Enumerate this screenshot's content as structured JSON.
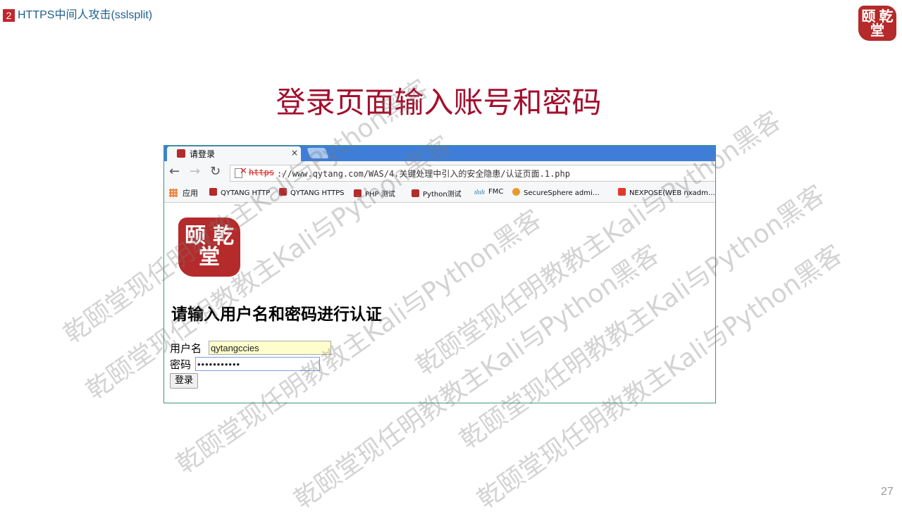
{
  "slide": {
    "section_number": "2",
    "section_title": "HTTPS中间人攻击(sslsplit)",
    "heading": "登录页面输入账号和密码",
    "page_number": "27",
    "watermark": "乾颐堂现任明教教主Kali与Python黑客"
  },
  "logo": {
    "text": [
      "颐",
      "乾",
      "堂"
    ],
    "color": "#b52a2a"
  },
  "browser": {
    "tab": {
      "title": "请登录",
      "close": "×"
    },
    "nav": {
      "back": "←",
      "forward": "→",
      "reload": "↻"
    },
    "address": {
      "scheme": "https",
      "rest": "://www.qytang.com/WAS/4.关键处理中引入的安全隐患/认证页面.1.php",
      "ssl_error_icon": "x-icon"
    },
    "bookmarks": {
      "apps_label": "应用",
      "items": [
        {
          "label": "QYTANG HTTP",
          "icon": "qytang-icon"
        },
        {
          "label": "QYTANG HTTPS",
          "icon": "qytang-icon"
        },
        {
          "label": "PHP 测试",
          "icon": "qytang-icon"
        },
        {
          "label": "Python测试",
          "icon": "qytang-icon"
        },
        {
          "label": "FMC",
          "icon": "cisco-icon"
        },
        {
          "label": "SecureSphere admi…",
          "icon": "securesphere-icon"
        },
        {
          "label": "NEXPOSE(WEB nxadm…",
          "icon": "nexpose-icon"
        }
      ]
    },
    "page": {
      "heading": "请输入用户名和密码进行认证",
      "username_label": "用户名",
      "username_value": "qytangccies",
      "password_label": "密码",
      "password_value": "•••••••••••",
      "login_button": "登录"
    }
  },
  "colors": {
    "heading": "#a30f2d",
    "section_badge": "#c0272d",
    "section_title": "#1f5f8b",
    "tabstrip": "#3f7ed8",
    "frame_border": "#3c9a74"
  }
}
